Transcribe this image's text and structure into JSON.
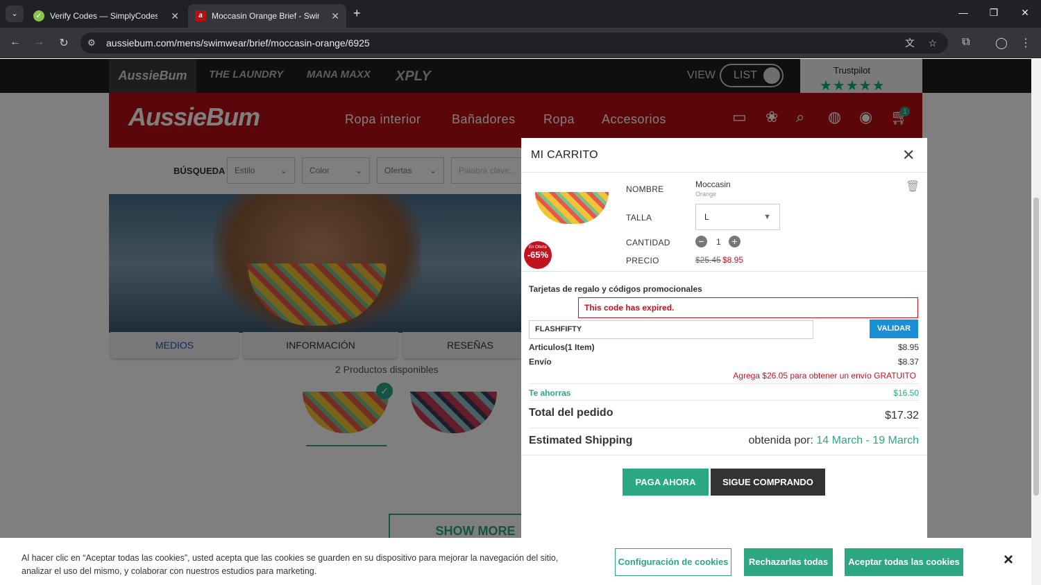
{
  "browser": {
    "tabs": [
      {
        "title": "Verify Codes — SimplyCodes",
        "active": false
      },
      {
        "title": "Moccasin Orange Brief - Swimw",
        "active": true
      }
    ],
    "new_tab": "+",
    "url": "aussiebum.com/mens/swimwear/brief/moccasin-orange/6925"
  },
  "brand_bar": {
    "brands": [
      "AussieBum",
      "THE LAUNDRY",
      "MANA MAXX",
      "XPLY"
    ],
    "view_label": "VIEW",
    "list_label": "LIST",
    "trustpilot": "Trustpilot"
  },
  "header": {
    "logo": "AussieBum",
    "menu": [
      "Ropa interior",
      "Bañadores",
      "Ropa",
      "Accesorios"
    ],
    "cart_count": "1"
  },
  "search": {
    "label": "BÚSQUEDA",
    "filters": [
      "Estilo",
      "Color",
      "Ofertas"
    ],
    "keyword_placeholder": "Palabra clave..."
  },
  "product": {
    "tabs": [
      "MEDIOS",
      "INFORMACIÓN",
      "RESEÑAS"
    ],
    "available": "2 Productos disponibles",
    "show_more": "SHOW MORE"
  },
  "cart": {
    "title": "MI CARRITO",
    "item": {
      "name_label": "NOMBRE",
      "name": "Moccasin",
      "color": "Orange",
      "size_label": "TALLA",
      "size": "L",
      "qty_label": "CANTIDAD",
      "qty": "1",
      "price_label": "PRECIO",
      "old_price": "$25.45",
      "price": "$8.95",
      "badge_small": "En Oferta",
      "badge": "-65%"
    },
    "promo_title": "Tarjetas de regalo y códigos promocionales",
    "promo_error": "This code has expired.",
    "promo_code": "FLASHFIFTY",
    "validate": "VALIDAR",
    "articles_label": "Articulos(1 Item)",
    "articles_value": "$8.95",
    "shipping_label": "Envío",
    "shipping_value": "$8.37",
    "free_shipping_note": "Agrega $26.05 para obtener un envío GRATUITO",
    "savings_label": "Te ahorras",
    "savings_value": "$16.50",
    "total_label": "Total del pedido",
    "total_value": "$17.32",
    "est_label": "Estimated Shipping",
    "est_prefix": "obtenida por:",
    "est_dates": "14 March - 19 March",
    "pay": "PAGA AHORA",
    "continue": "SIGUE COMPRANDO"
  },
  "cookie": {
    "text": "Al hacer clic en “Aceptar todas las cookies”, usted acepta que las cookies se guarden en su dispositivo para mejorar la navegación del sitio, analizar el uso del mismo, y colaborar con nuestros estudios para marketing.",
    "settings": "Configuración de cookies",
    "reject": "Rechazarlas todas",
    "accept": "Aceptar todas las cookies",
    "close": "×"
  },
  "colors": {
    "brand_red": "#b70f14",
    "teal": "#2ba784",
    "blue": "#1a8fd6",
    "error_red": "#d0021b"
  }
}
